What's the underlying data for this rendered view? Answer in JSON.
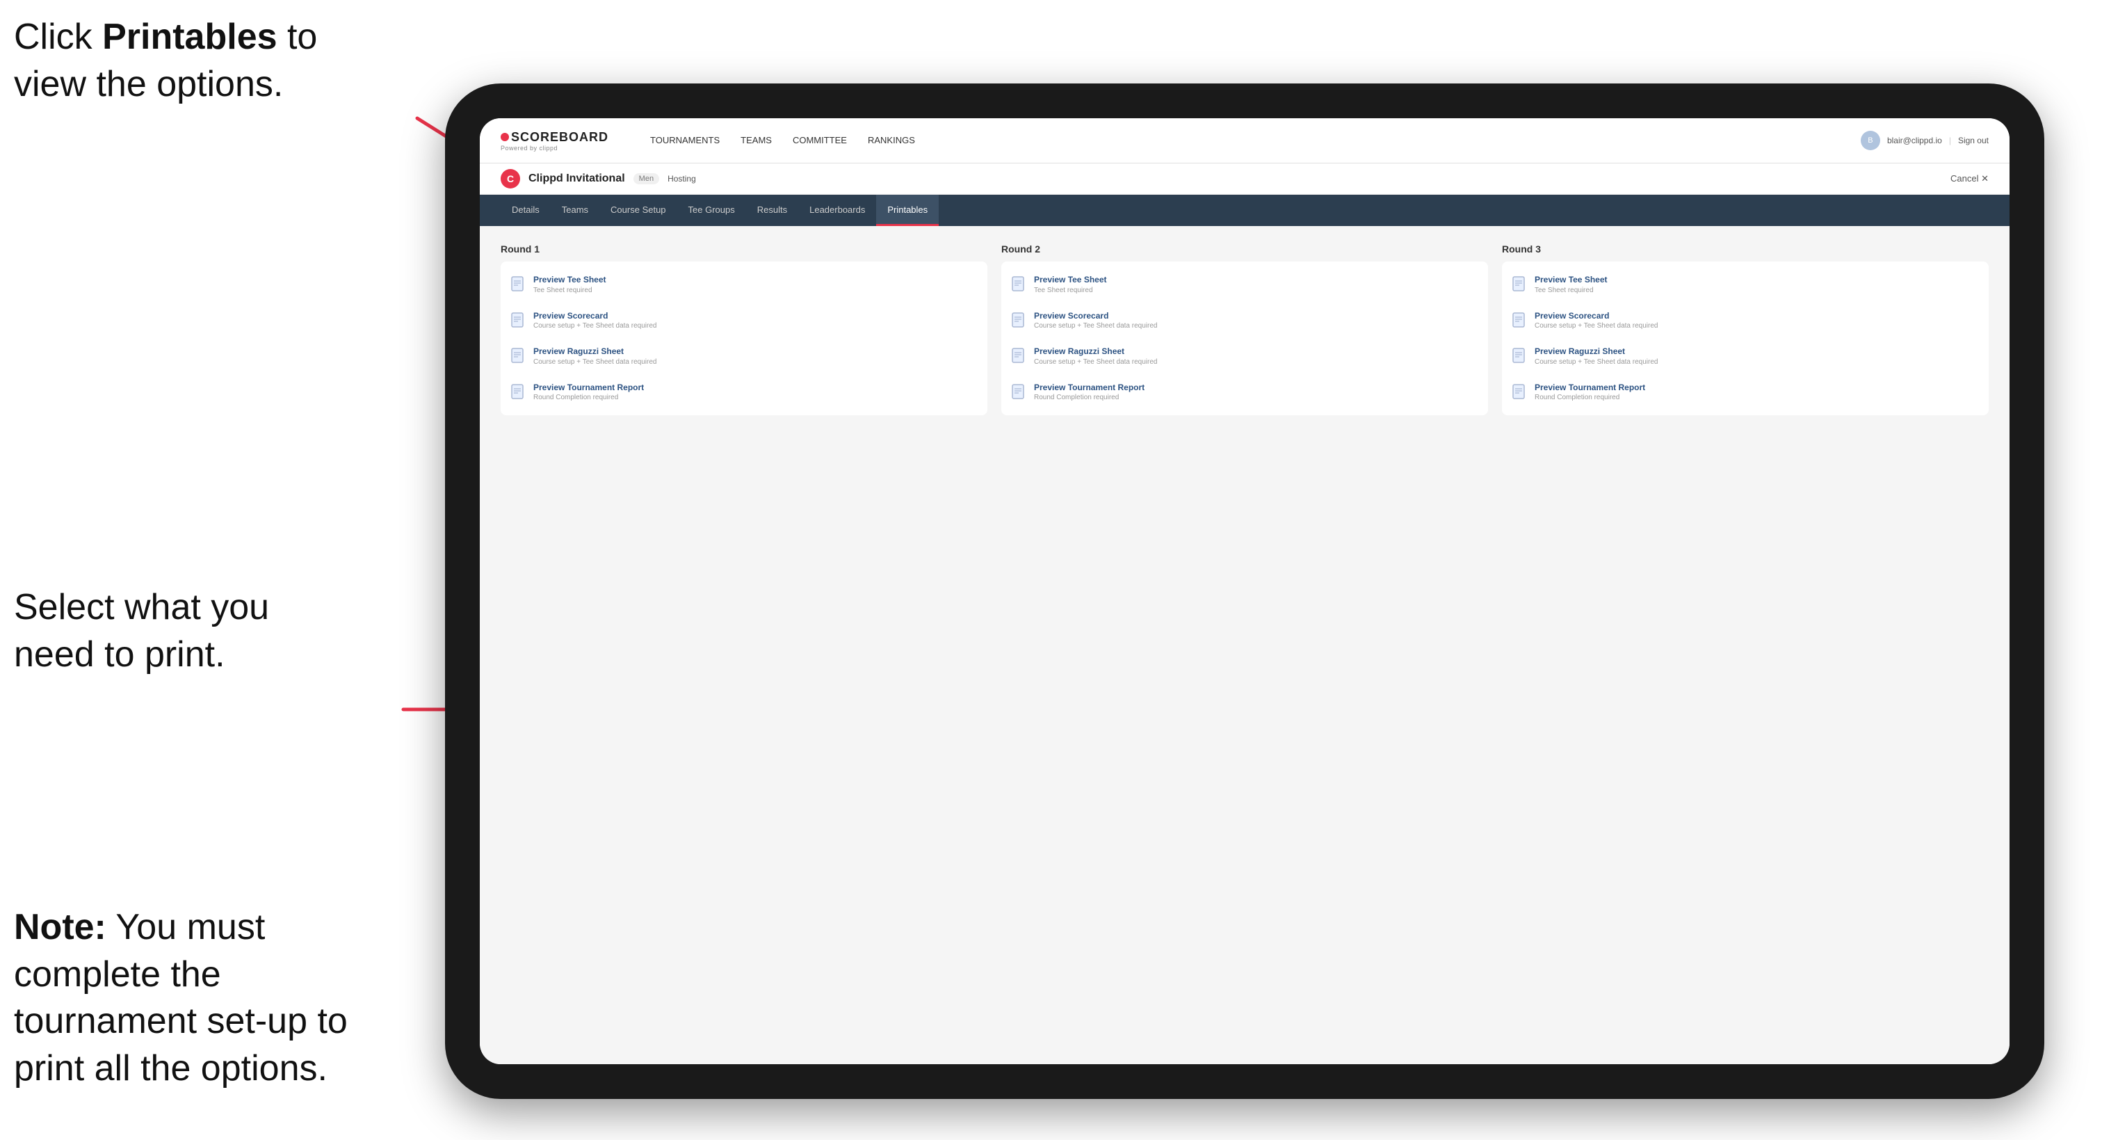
{
  "instructions": {
    "top": "Click Printables to view the options.",
    "top_bold": "Printables",
    "middle": "Select what you need to print.",
    "bottom_bold": "Note:",
    "bottom": " You must complete the tournament set-up to print all the options."
  },
  "nav": {
    "brand_title": "SCOREBOARD",
    "brand_sub": "Powered by clippd",
    "links": [
      {
        "label": "TOURNAMENTS",
        "active": false
      },
      {
        "label": "TEAMS",
        "active": false
      },
      {
        "label": "COMMITTEE",
        "active": false
      },
      {
        "label": "RANKINGS",
        "active": false
      }
    ],
    "user_email": "blair@clippd.io",
    "sign_out": "Sign out"
  },
  "tournament": {
    "logo": "C",
    "name": "Clippd Invitational",
    "badge": "Men",
    "status": "Hosting",
    "cancel": "Cancel ✕"
  },
  "sub_tabs": [
    {
      "label": "Details",
      "active": false
    },
    {
      "label": "Teams",
      "active": false
    },
    {
      "label": "Course Setup",
      "active": false
    },
    {
      "label": "Tee Groups",
      "active": false
    },
    {
      "label": "Results",
      "active": false
    },
    {
      "label": "Leaderboards",
      "active": false
    },
    {
      "label": "Printables",
      "active": true
    }
  ],
  "rounds": [
    {
      "title": "Round 1",
      "items": [
        {
          "title": "Preview Tee Sheet",
          "sub": "Tee Sheet required"
        },
        {
          "title": "Preview Scorecard",
          "sub": "Course setup + Tee Sheet data required"
        },
        {
          "title": "Preview Raguzzi Sheet",
          "sub": "Course setup + Tee Sheet data required"
        },
        {
          "title": "Preview Tournament Report",
          "sub": "Round Completion required"
        }
      ]
    },
    {
      "title": "Round 2",
      "items": [
        {
          "title": "Preview Tee Sheet",
          "sub": "Tee Sheet required"
        },
        {
          "title": "Preview Scorecard",
          "sub": "Course setup + Tee Sheet data required"
        },
        {
          "title": "Preview Raguzzi Sheet",
          "sub": "Course setup + Tee Sheet data required"
        },
        {
          "title": "Preview Tournament Report",
          "sub": "Round Completion required"
        }
      ]
    },
    {
      "title": "Round 3",
      "items": [
        {
          "title": "Preview Tee Sheet",
          "sub": "Tee Sheet required"
        },
        {
          "title": "Preview Scorecard",
          "sub": "Course setup + Tee Sheet data required"
        },
        {
          "title": "Preview Raguzzi Sheet",
          "sub": "Course setup + Tee Sheet data required"
        },
        {
          "title": "Preview Tournament Report",
          "sub": "Round Completion required"
        }
      ]
    }
  ]
}
